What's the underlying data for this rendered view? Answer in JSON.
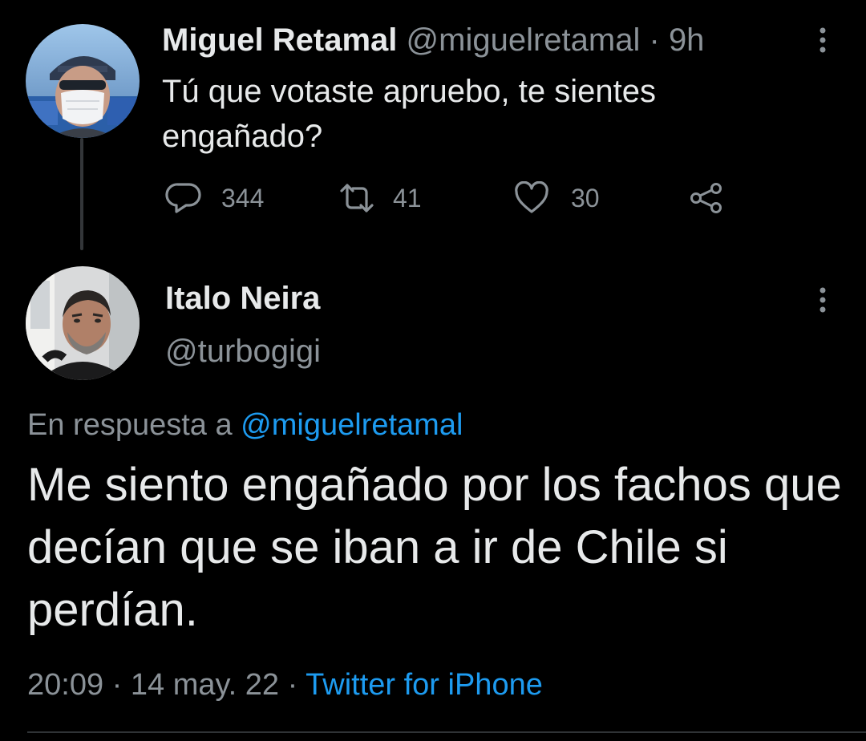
{
  "thread": {
    "parent_tweet": {
      "name": "Miguel Retamal",
      "handle": "@miguelretamal",
      "separator": "·",
      "time": "9h",
      "text": "Tú que votaste apruebo, te sientes engañado?",
      "replies": "344",
      "retweets": "41",
      "likes": "30"
    },
    "reply_tweet": {
      "name": "Italo Neira",
      "handle": "@turbogigi",
      "reply_prefix": "En respuesta a",
      "reply_mention": "@miguelretamal",
      "text": "Me siento engañado por los fachos que decían que se iban a ir de Chile si perdían.",
      "time": "20:09",
      "date": "14 may. 22",
      "separator": "·",
      "source": "Twitter for iPhone"
    }
  },
  "icons": {
    "reply": "reply-icon",
    "retweet": "retweet-icon",
    "like": "heart-icon",
    "share": "share-icon",
    "more": "more-vertical-icon"
  },
  "colors": {
    "background": "#000000",
    "text": "#e7e9ea",
    "secondary": "#8b9298",
    "accent": "#1d9bf0"
  }
}
